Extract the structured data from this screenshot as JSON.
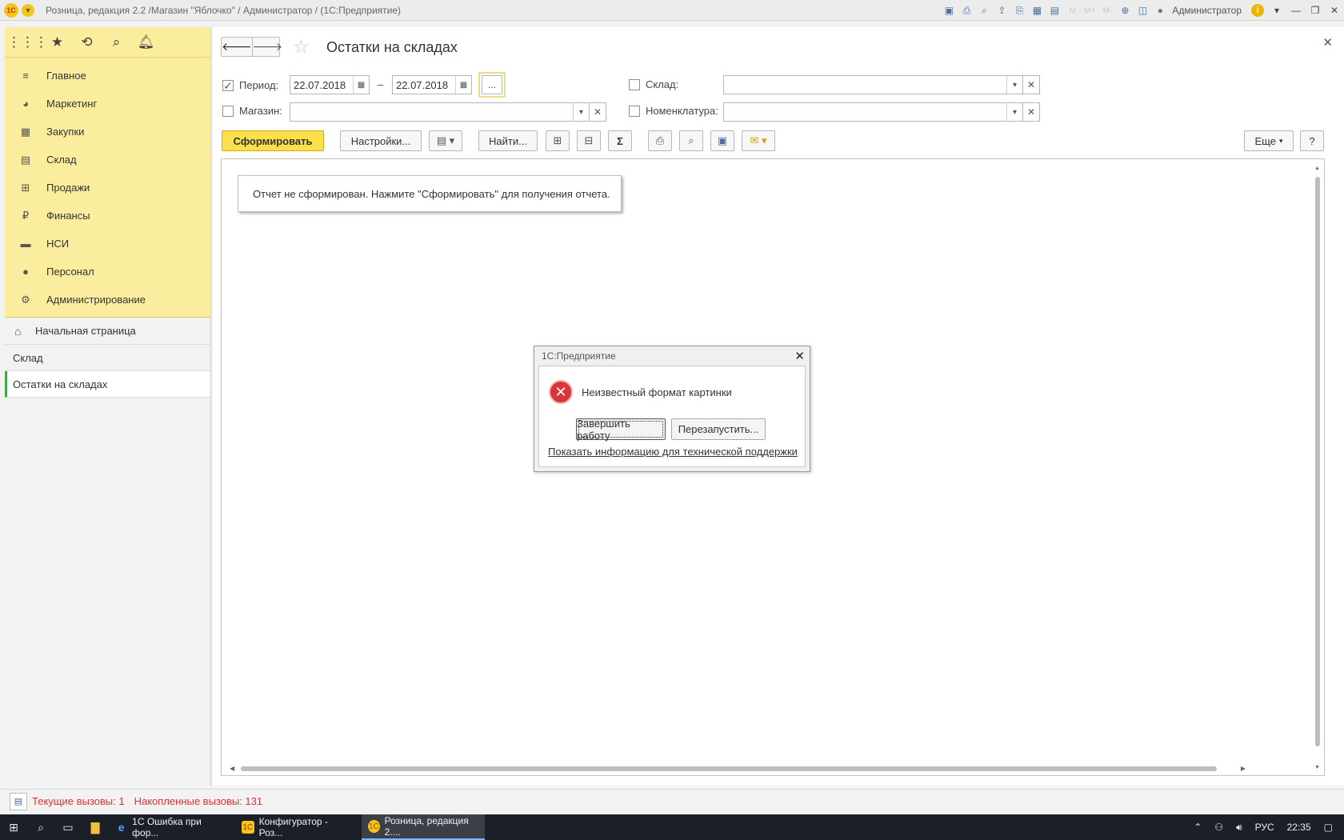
{
  "window": {
    "title": "Розница, редакция 2.2 /Магазин \"Яблочко\" / Администратор /  (1С:Предприятие)",
    "user": "Администратор",
    "logo_text": "1С"
  },
  "sidebar": {
    "sections": [
      {
        "label": "Главное",
        "icon": "≡"
      },
      {
        "label": "Маркетинг",
        "icon": "◕"
      },
      {
        "label": "Закупки",
        "icon": "▦"
      },
      {
        "label": "Склад",
        "icon": "▤"
      },
      {
        "label": "Продажи",
        "icon": "⊞"
      },
      {
        "label": "Финансы",
        "icon": "₽"
      },
      {
        "label": "НСИ",
        "icon": "▬"
      },
      {
        "label": "Персонал",
        "icon": "●"
      },
      {
        "label": "Администрирование",
        "icon": "⚙"
      }
    ],
    "home": "Начальная страница",
    "nav": [
      "Склад",
      "Остатки на складах"
    ]
  },
  "form": {
    "title": "Остатки на складах",
    "period_label": "Период:",
    "period_checked": true,
    "date_from": "22.07.2018",
    "date_to": "22.07.2018",
    "date_separator": "–",
    "dots": "...",
    "warehouse_label": "Склад:",
    "store_label": "Магазин:",
    "nomenclature_label": "Номенклатура:"
  },
  "toolbar": {
    "generate": "Сформировать",
    "settings": "Настройки...",
    "find": "Найти...",
    "more": "Еще",
    "help": "?"
  },
  "report": {
    "message": "Отчет не сформирован. Нажмите \"Сформировать\" для получения отчета."
  },
  "dialog": {
    "title": "1С:Предприятие",
    "message": "Неизвестный формат картинки",
    "button_exit": "Завершить работу",
    "button_restart": "Перезапустить...",
    "link": "Показать информацию для технической поддержки"
  },
  "status": {
    "current_calls": "Текущие вызовы: 1",
    "accumulated_calls": "Накопленные вызовы: 131"
  },
  "taskbar": {
    "apps": [
      {
        "label": "1С Ошибка при фор...",
        "icon": "e"
      },
      {
        "label": "Конфигуратор - Роз...",
        "icon": "1C"
      },
      {
        "label": "Розница, редакция 2....",
        "icon": "1C"
      }
    ],
    "lang": "РУС",
    "time": "22:35"
  },
  "colors": {
    "accent_yellow": "#fbe049",
    "sidebar_yellow": "#fbed9e",
    "status_red": "#e03030",
    "error_red": "#d9353a"
  }
}
